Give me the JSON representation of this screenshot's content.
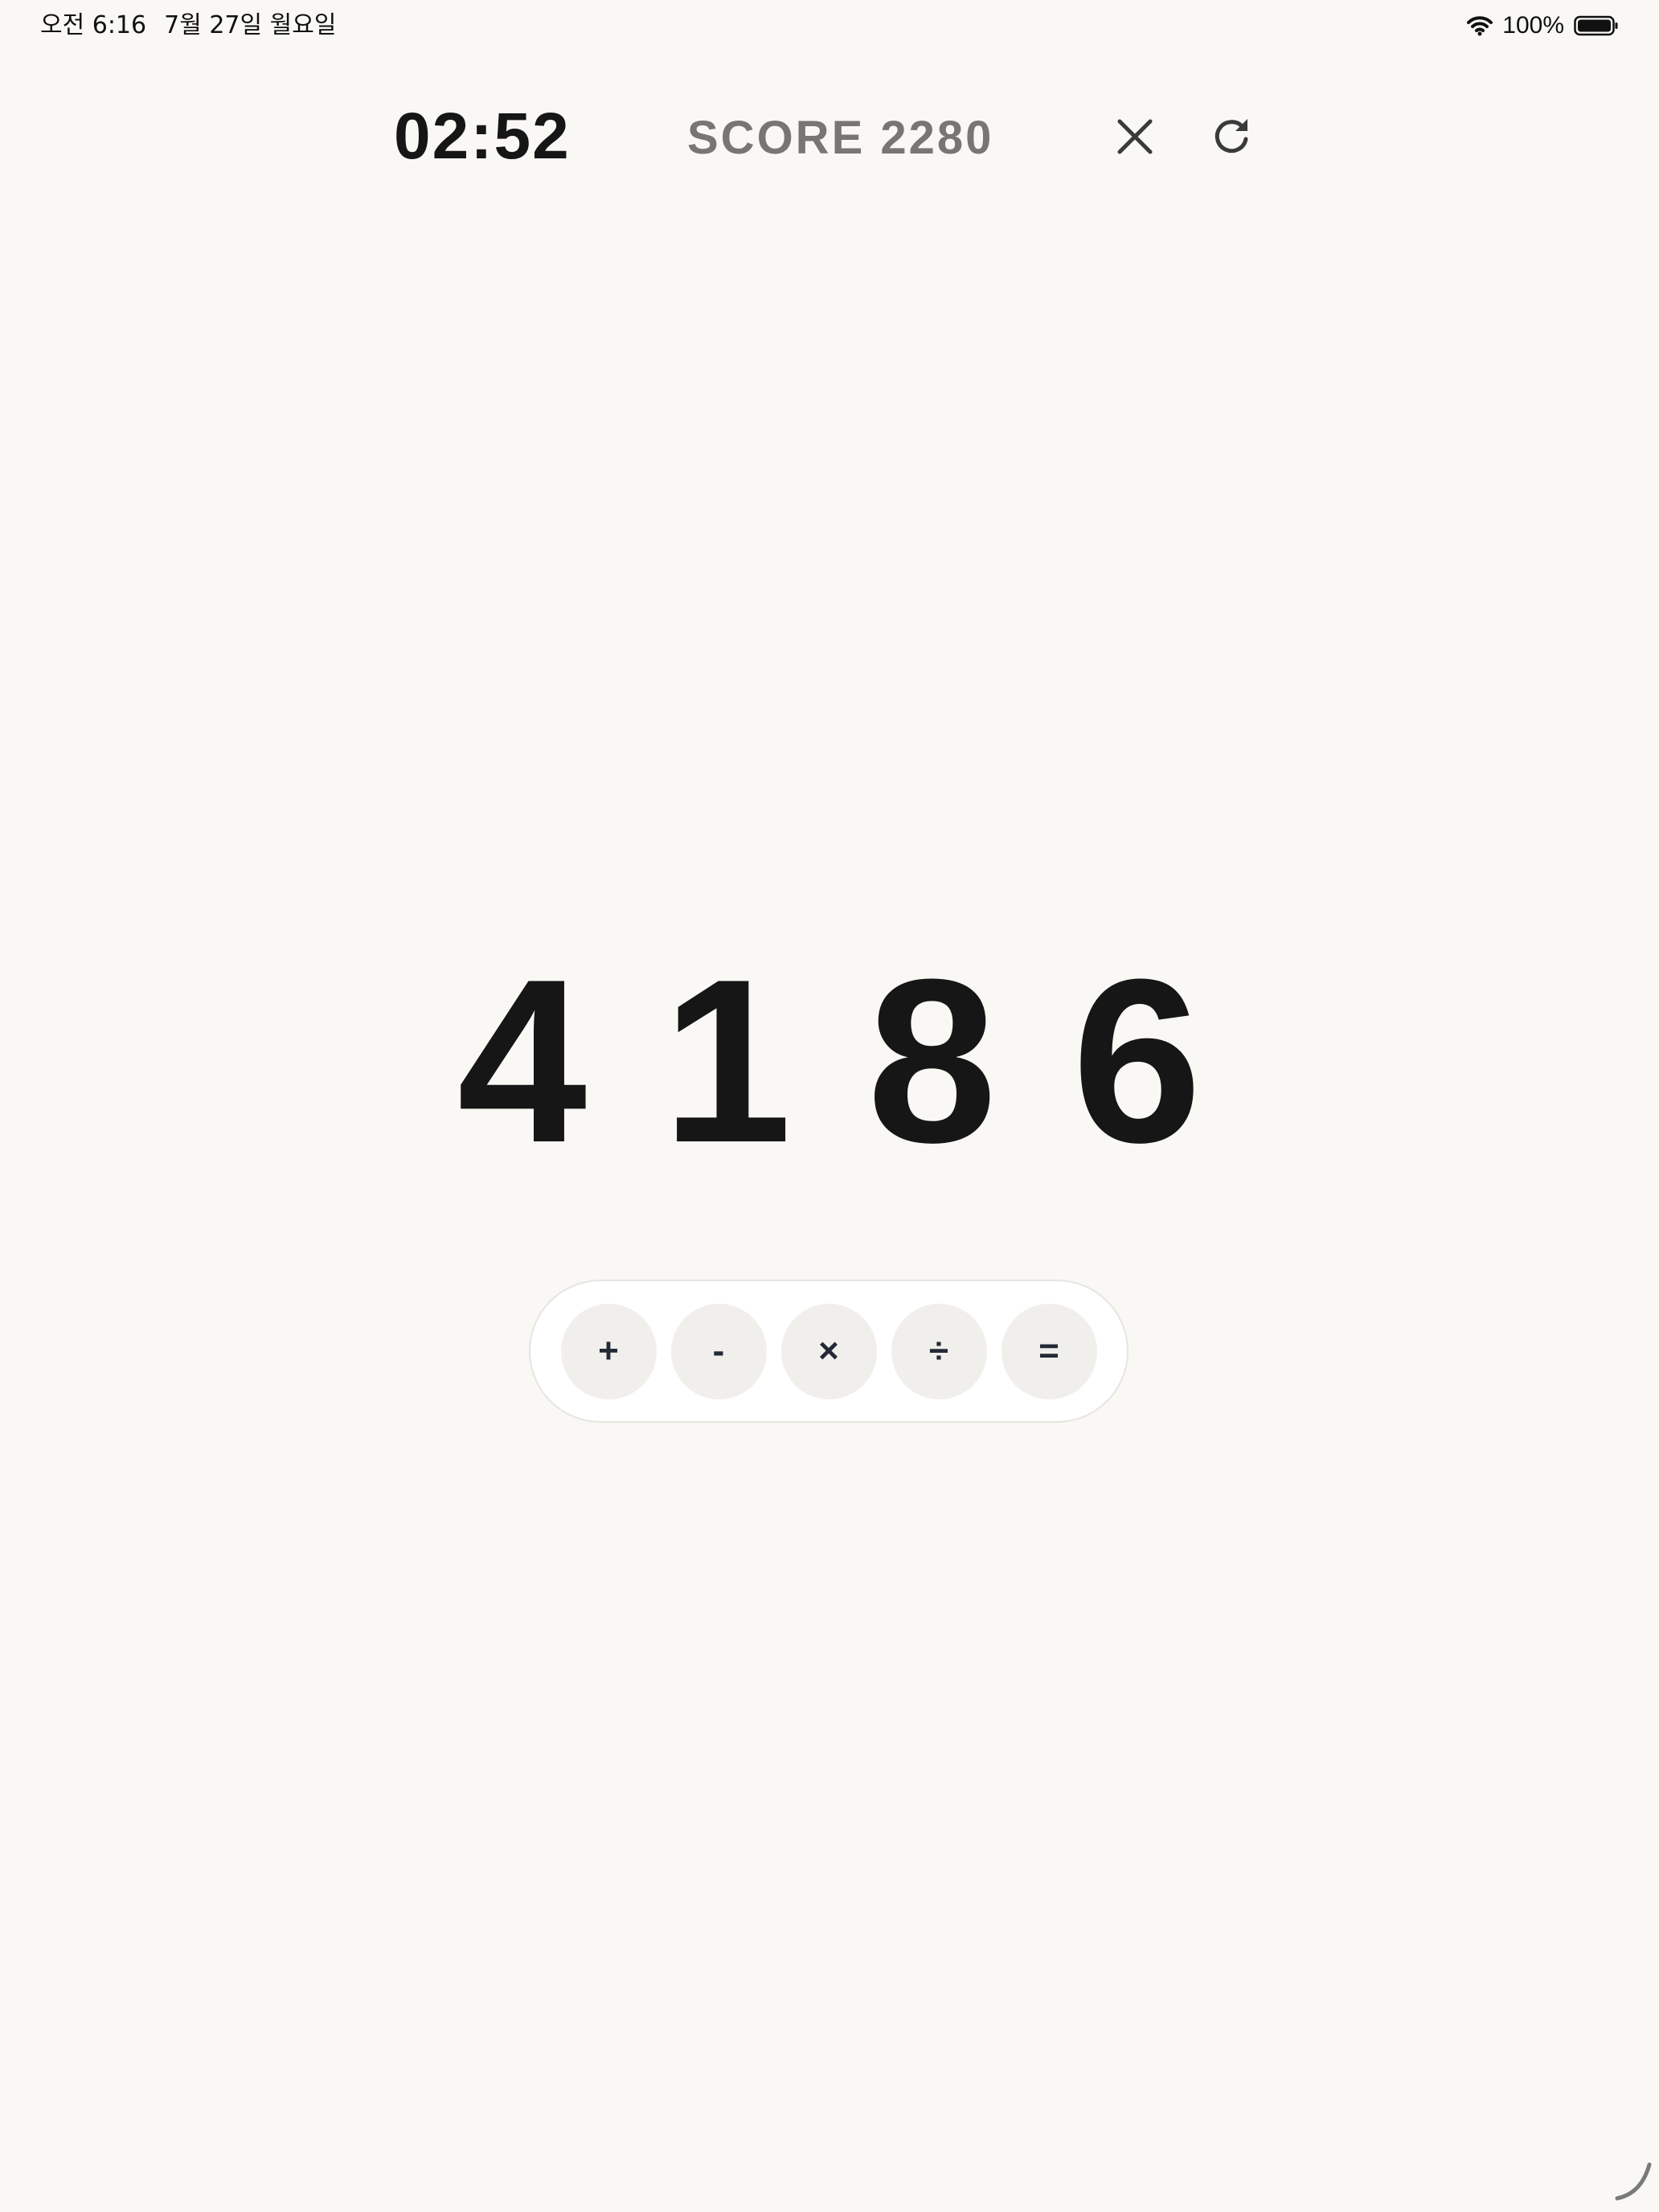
{
  "status_bar": {
    "time": "오전 6:16",
    "date": "7월 27일 월요일",
    "battery": "100%",
    "icons": [
      "wifi-icon",
      "battery-icon"
    ]
  },
  "game": {
    "timer": "02:52",
    "score": "SCORE 2280",
    "controls": [
      "close-icon",
      "restart-icon"
    ]
  },
  "puzzle": {
    "digits": [
      "4",
      "1",
      "8",
      "6"
    ]
  },
  "operators": [
    "+",
    "-",
    "×",
    "÷",
    "="
  ],
  "colors": {
    "background": "#f9f8f5",
    "text": "#161616",
    "score": "#787672",
    "operator_bg": "#f1efeb",
    "operator_text": "#232a36"
  }
}
